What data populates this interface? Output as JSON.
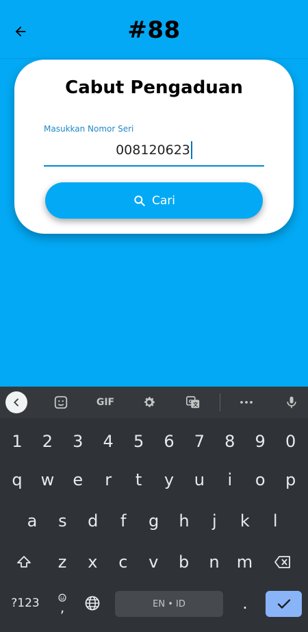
{
  "header": {
    "title": "#88",
    "back_icon": "arrow-left-icon"
  },
  "card": {
    "title": "Cabut Pengaduan",
    "field": {
      "label": "Masukkan Nomor Seri",
      "value": "008120623"
    },
    "search_button": {
      "label": "Cari",
      "icon": "search-icon"
    }
  },
  "keyboard": {
    "toolbar": {
      "collapse_icon": "chevron-left-icon",
      "sticker_icon": "sticker-icon",
      "gif_label": "GIF",
      "settings_icon": "gear-icon",
      "translate_icon": "translate-icon",
      "more_label": "•••",
      "mic_icon": "microphone-icon"
    },
    "row_numbers": [
      "1",
      "2",
      "3",
      "4",
      "5",
      "6",
      "7",
      "8",
      "9",
      "0"
    ],
    "row1": [
      "q",
      "w",
      "e",
      "r",
      "t",
      "y",
      "u",
      "i",
      "o",
      "p"
    ],
    "row2": [
      "a",
      "s",
      "d",
      "f",
      "g",
      "h",
      "j",
      "k",
      "l"
    ],
    "row3": [
      "z",
      "x",
      "c",
      "v",
      "b",
      "n",
      "m"
    ],
    "shift_icon": "shift-icon",
    "backspace_icon": "backspace-icon",
    "symbols_label": "?123",
    "emoji_comma": ",",
    "emoji_icon": "emoji-icon",
    "globe_icon": "globe-icon",
    "space_label": "EN • ID",
    "period_label": ".",
    "enter_icon": "check-icon"
  },
  "colors": {
    "primary": "#03A9F4",
    "keyboard_bg": "#2f3337",
    "enter_key": "#8ab4f8"
  }
}
